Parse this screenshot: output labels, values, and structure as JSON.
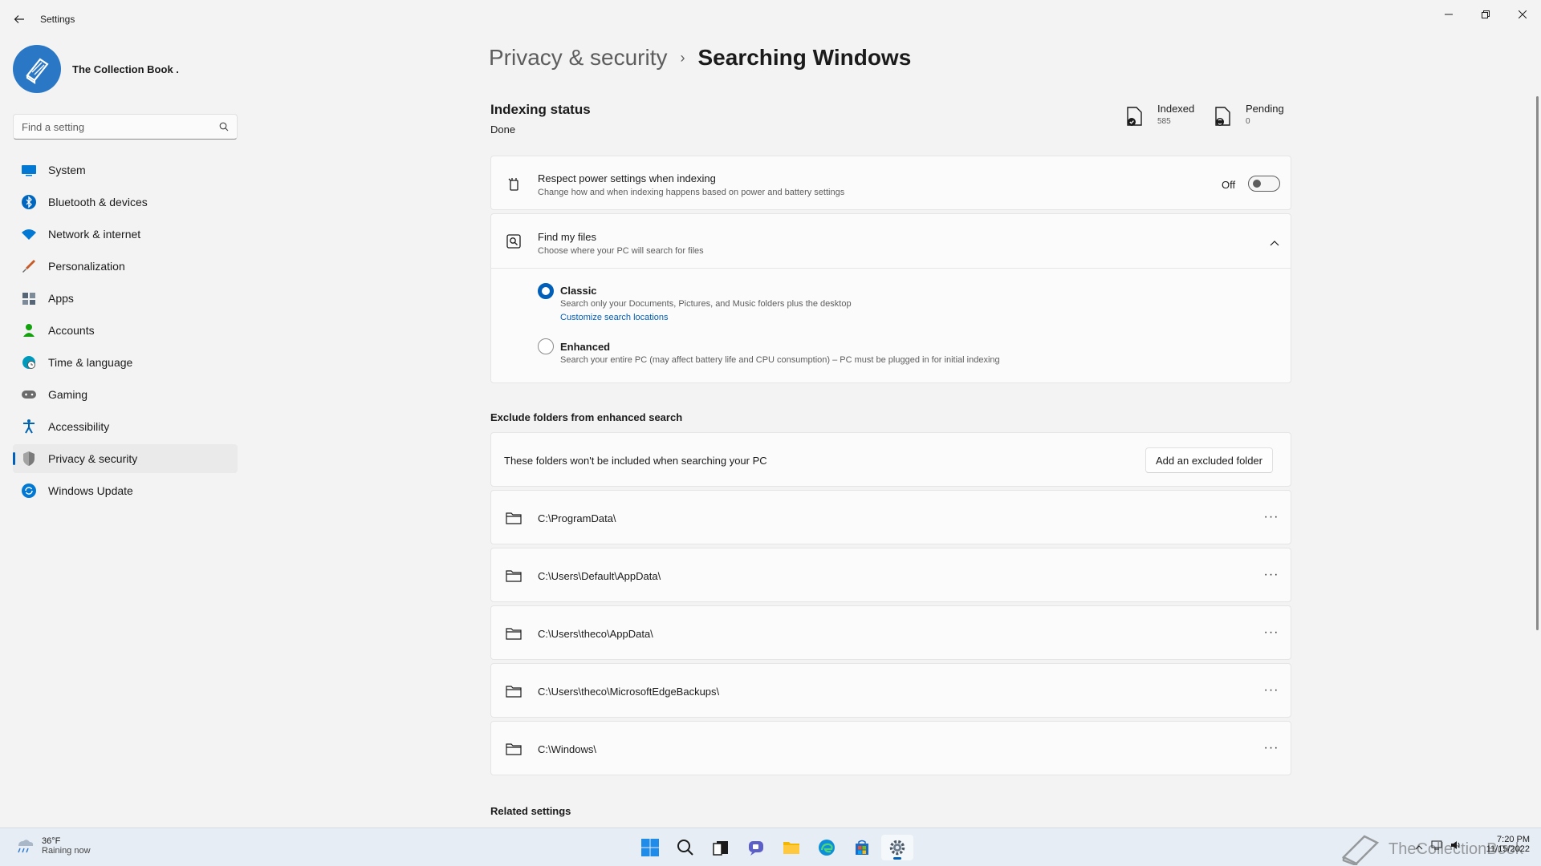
{
  "app": {
    "title": "Settings"
  },
  "profile": {
    "name": "The Collection Book ."
  },
  "search": {
    "placeholder": "Find a setting"
  },
  "sidebar": {
    "items": [
      {
        "label": "System",
        "icon": "monitor-icon",
        "color": "#0078d4"
      },
      {
        "label": "Bluetooth & devices",
        "icon": "bluetooth-icon",
        "color": "#0067c0"
      },
      {
        "label": "Network & internet",
        "icon": "wifi-icon",
        "color": "#0078d4"
      },
      {
        "label": "Personalization",
        "icon": "brush-icon",
        "color": "#c75b27"
      },
      {
        "label": "Apps",
        "icon": "apps-icon",
        "color": "#566677"
      },
      {
        "label": "Accounts",
        "icon": "person-icon",
        "color": "#13a10e"
      },
      {
        "label": "Time & language",
        "icon": "globe-clock-icon",
        "color": "#0099bc"
      },
      {
        "label": "Gaming",
        "icon": "gamepad-icon",
        "color": "#6b6b6b"
      },
      {
        "label": "Accessibility",
        "icon": "accessibility-icon",
        "color": "#0063b1"
      },
      {
        "label": "Privacy & security",
        "icon": "shield-icon",
        "color": "#7a7a7a",
        "active": true
      },
      {
        "label": "Windows Update",
        "icon": "update-icon",
        "color": "#0078d4"
      }
    ]
  },
  "breadcrumb": {
    "parent": "Privacy & security",
    "separator": "›",
    "current": "Searching Windows"
  },
  "indexing": {
    "title": "Indexing status",
    "status": "Done",
    "indexed_label": "Indexed",
    "indexed_count": "585",
    "pending_label": "Pending",
    "pending_count": "0"
  },
  "power": {
    "title": "Respect power settings when indexing",
    "subtitle": "Change how and when indexing happens based on power and battery settings",
    "toggle_state": "Off"
  },
  "find_files": {
    "title": "Find my files",
    "subtitle": "Choose where your PC will search for files",
    "classic_label": "Classic",
    "classic_desc": "Search only your Documents, Pictures, and Music folders plus the desktop",
    "customize_link": "Customize search locations",
    "enhanced_label": "Enhanced",
    "enhanced_desc": "Search your entire PC (may affect battery life and CPU consumption) – PC must be plugged in for initial indexing",
    "selected": "Classic"
  },
  "exclude": {
    "section_title": "Exclude folders from enhanced search",
    "description": "These folders won't be included when searching your PC",
    "add_button": "Add an excluded folder",
    "more_label": "···",
    "folders": [
      "C:\\ProgramData\\",
      "C:\\Users\\Default\\AppData\\",
      "C:\\Users\\theco\\AppData\\",
      "C:\\Users\\theco\\MicrosoftEdgeBackups\\",
      "C:\\Windows\\"
    ]
  },
  "related": {
    "title": "Related settings"
  },
  "taskbar": {
    "weather_temp": "36°F",
    "weather_desc": "Raining now",
    "time": "7:20 PM",
    "date": "11/15/2022",
    "watermark": "TheCollectionBook"
  },
  "colors": {
    "accent": "#005fb8",
    "taskbar": "#e6edf5",
    "background": "#f3f3f3"
  }
}
